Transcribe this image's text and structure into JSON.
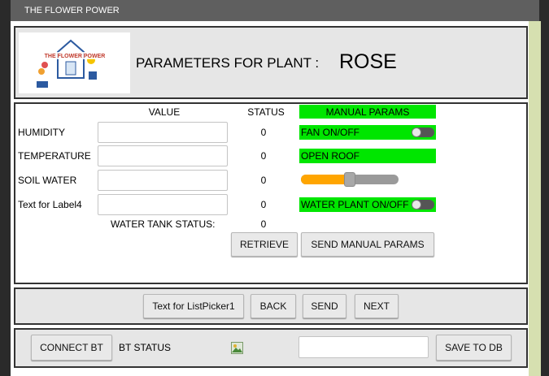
{
  "window": {
    "title": "THE FLOWER POWER"
  },
  "header": {
    "logo_icon": "flower-power-logo",
    "logo_text": "THE FLOWER POWER",
    "params_label": "PARAMETERS FOR PLANT :",
    "plant_name": "ROSE"
  },
  "table": {
    "col_value": "VALUE",
    "col_status": "STATUS",
    "col_manual": "MANUAL PARAMS",
    "rows": [
      {
        "label": "HUMIDITY",
        "value": "",
        "status": "0"
      },
      {
        "label": "TEMPERATURE",
        "value": "",
        "status": "0"
      },
      {
        "label": "SOIL WATER",
        "value": "",
        "status": "0"
      },
      {
        "label": "Text for Label4",
        "value": "",
        "status": "0"
      }
    ],
    "tank_label": "WATER TANK STATUS:",
    "tank_status": "0"
  },
  "manual": {
    "fan_label": "FAN ON/OFF",
    "fan_on": false,
    "roof_label": "OPEN ROOF",
    "slider_value_fraction": 0.5,
    "water_label": "WATER PLANT ON/OFF",
    "water_on": false
  },
  "buttons": {
    "retrieve": "RETRIEVE",
    "send_manual": "SEND MANUAL PARAMS",
    "listpicker": "Text for ListPicker1",
    "back": "BACK",
    "send": "SEND",
    "next": "NEXT",
    "connect_bt": "CONNECT BT",
    "save_db": "SAVE TO DB"
  },
  "footer": {
    "bt_status": "BT STATUS",
    "image_icon": "broken-image-icon",
    "db_input_value": ""
  },
  "colors": {
    "accent_green": "#00e600",
    "slider_fill": "#ffa500",
    "titlebar": "#5f5f5f"
  }
}
